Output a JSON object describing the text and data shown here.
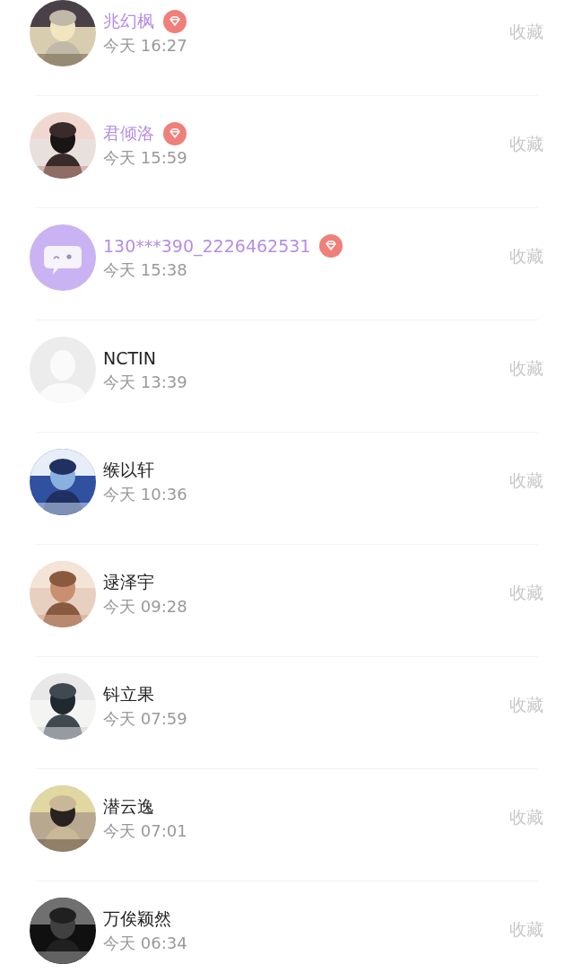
{
  "users": [
    {
      "name": "兆幻枫",
      "time": "今天 16:27",
      "vip": true,
      "action": "收藏"
    },
    {
      "name": "君倾洛",
      "time": "今天 15:59",
      "vip": true,
      "action": "收藏"
    },
    {
      "name": "130***390_2226462531",
      "time": "今天 15:38",
      "vip": true,
      "avatar": {
        "kind": "app"
      },
      "action": "收藏"
    },
    {
      "name": "NCTIN",
      "time": "今天 13:39",
      "vip": false,
      "avatar": {
        "kind": "default"
      },
      "action": "收藏"
    },
    {
      "name": "缑以轩",
      "time": "今天 10:36",
      "vip": false,
      "action": "收藏"
    },
    {
      "name": "逯泽宇",
      "time": "今天 09:28",
      "vip": false,
      "action": "收藏"
    },
    {
      "name": "钭立果",
      "time": "今天 07:59",
      "vip": false,
      "action": "收藏"
    },
    {
      "name": "潜云逸",
      "time": "今天 07:01",
      "vip": false,
      "action": "收藏"
    },
    {
      "name": "万俟颖然",
      "time": "今天 06:34",
      "vip": false,
      "action": "收藏"
    }
  ]
}
